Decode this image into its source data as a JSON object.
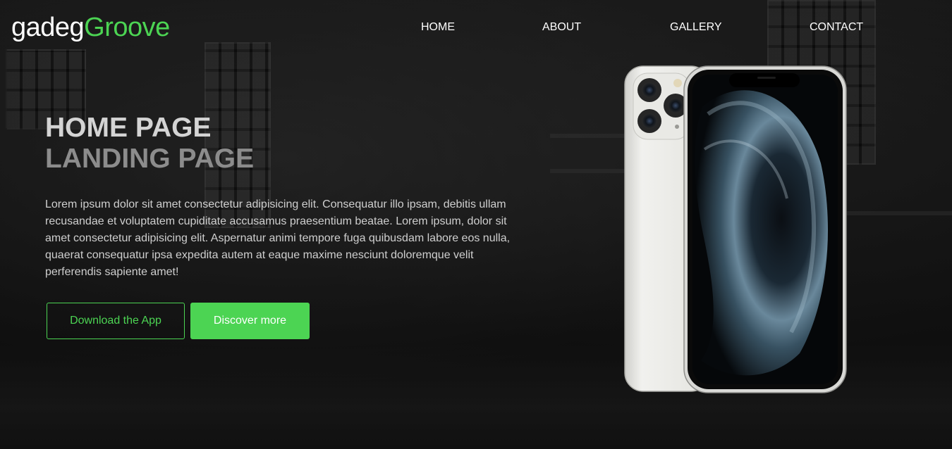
{
  "brand": {
    "name_part1": "gadeg",
    "name_part2": "Groove",
    "accent": "#4cd453"
  },
  "nav": {
    "items": [
      {
        "label": "HOME"
      },
      {
        "label": "ABOUT"
      },
      {
        "label": "GALLERY"
      },
      {
        "label": "CONTACT"
      }
    ]
  },
  "hero": {
    "title_line1": "HOME PAGE",
    "title_line2": "LANDING PAGE",
    "paragraph": "Lorem ipsum dolor sit amet consectetur adipisicing elit. Consequatur illo ipsam, debitis ullam recusandae et voluptatem cupiditate accusamus praesentium beatae. Lorem ipsum, dolor sit amet consectetur adipisicing elit. Aspernatur animi tempore fuga quibusdam labore eos nulla, quaerat consequatur ipsa expedita autem at eaque maxime nesciunt doloremque velit perferendis sapiente amet!",
    "download_button": "Download the App",
    "discover_button": "Discover more"
  },
  "colors": {
    "accent": "#4cd453",
    "text": "#ffffff"
  }
}
